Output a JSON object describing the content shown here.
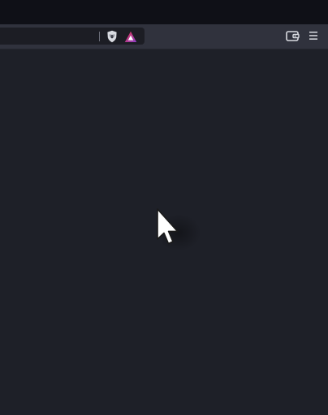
{
  "window": {
    "background": "#1e2028",
    "toolbar_background": "#30323d",
    "title_strip_background": "#0f1017"
  },
  "toolbar": {
    "address_bar": {
      "value": "",
      "placeholder": ""
    },
    "icons": {
      "shields": "brave-shields-icon",
      "rewards": "brave-rewards-icon",
      "wallet": "wallet-icon",
      "menu": "hamburger-menu-icon"
    },
    "accent_colors": {
      "rewards_red": "#e0354f",
      "rewards_purple": "#8a3fc7"
    }
  },
  "content": {
    "cursor_icon": "mouse-pointer-icon"
  }
}
